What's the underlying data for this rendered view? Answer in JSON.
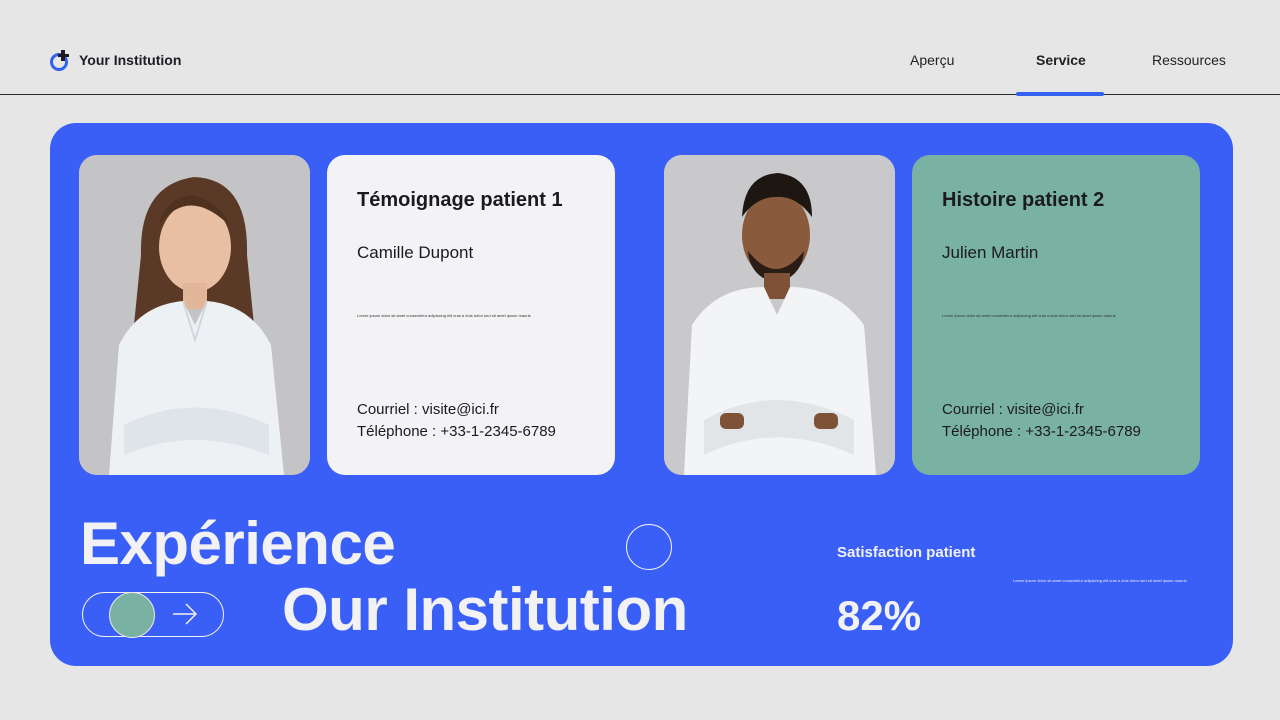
{
  "brand": {
    "name": "Your Institution",
    "logo_icon": "medical-cross-icon",
    "accent_color": "#3361f0"
  },
  "nav": {
    "items": [
      {
        "label": "Aperçu",
        "active": false
      },
      {
        "label": "Service",
        "active": true
      },
      {
        "label": "Ressources",
        "active": false
      }
    ]
  },
  "colors": {
    "panel": "#3a5ff7",
    "card_light": "#f3f3f5",
    "card_teal": "#79b1a2",
    "background": "#e6e6e7"
  },
  "testimonials": [
    {
      "title": "Témoignage patient 1",
      "name": "Camille Dupont",
      "body": "Lorem ipsum dolor sit amet consectetur adipiscing elit cras a duis tortor sed sit amet ipsum mauris",
      "email": "Courriel : visite@ici.fr",
      "phone": "Téléphone : +33-1-2345-6789",
      "photo_icon": "woman-portrait-photo"
    },
    {
      "title": "Histoire patient 2",
      "name": "Julien Martin",
      "body": "Lorem ipsum dolor sit amet consectetur adipiscing elit cras a duis tortor sed sit amet ipsum mauris",
      "email": "Courriel : visite@ici.fr",
      "phone": "Téléphone : +33-1-2345-6789",
      "photo_icon": "man-portrait-photo"
    }
  ],
  "hero": {
    "line1": "Expérience",
    "line2": "Our Institution",
    "toggle_icon": "arrow-right-icon"
  },
  "stat": {
    "label": "Satisfaction patient",
    "description": "Lorem ipsum dolor sit amet consectetur adipiscing elit cras a duis tortor sed sit amet ipsum mauris",
    "value": "82%",
    "value_percent": 82
  }
}
